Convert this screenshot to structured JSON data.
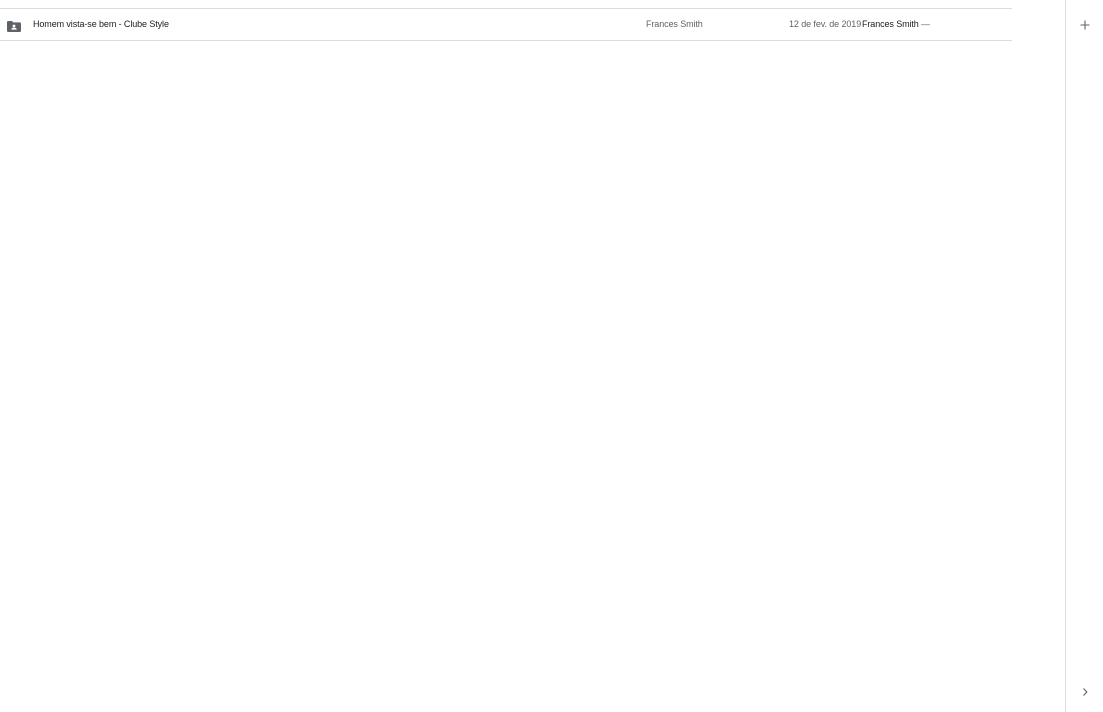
{
  "files": [
    {
      "icon": "shared-folder-icon",
      "name": "Homem vista-se bem - Clube Style",
      "owner": "Frances Smith",
      "modified_date": "12 de fev. de 2019",
      "modified_by": "Frances Smith",
      "size": "—"
    }
  ],
  "side_panel": {
    "add_icon": "plus-icon",
    "expand_icon": "chevron-right-icon"
  },
  "colors": {
    "divider": "#dadce0",
    "text_primary": "#202124",
    "text_secondary": "#5f6368",
    "icon": "#5f6368"
  }
}
